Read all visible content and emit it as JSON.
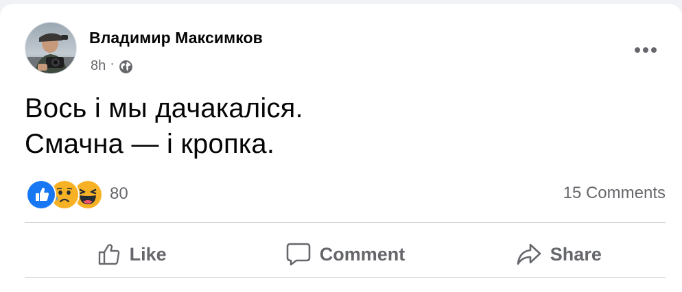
{
  "post": {
    "author": "Владимир Максимков",
    "time": "8h",
    "separator": "·",
    "privacy_icon": "globe-icon",
    "more_icon": "more-options-icon",
    "text_lines": [
      "Вось і мы дачакаліся.",
      "Смачна — і кропка."
    ]
  },
  "stats": {
    "reaction_icons": [
      "like-reaction-icon",
      "sad-reaction-icon",
      "haha-reaction-icon"
    ],
    "reactions_count": "80",
    "comments_label": "15 Comments"
  },
  "actions": {
    "like": {
      "label": "Like",
      "icon": "thumbs-up-icon"
    },
    "comment": {
      "label": "Comment",
      "icon": "comment-icon"
    },
    "share": {
      "label": "Share",
      "icon": "share-icon"
    }
  },
  "colors": {
    "like_blue": "#1877f2",
    "reaction_yellow": "#f7b125",
    "secondary_text": "#65676b",
    "divider": "#ced0d4"
  }
}
